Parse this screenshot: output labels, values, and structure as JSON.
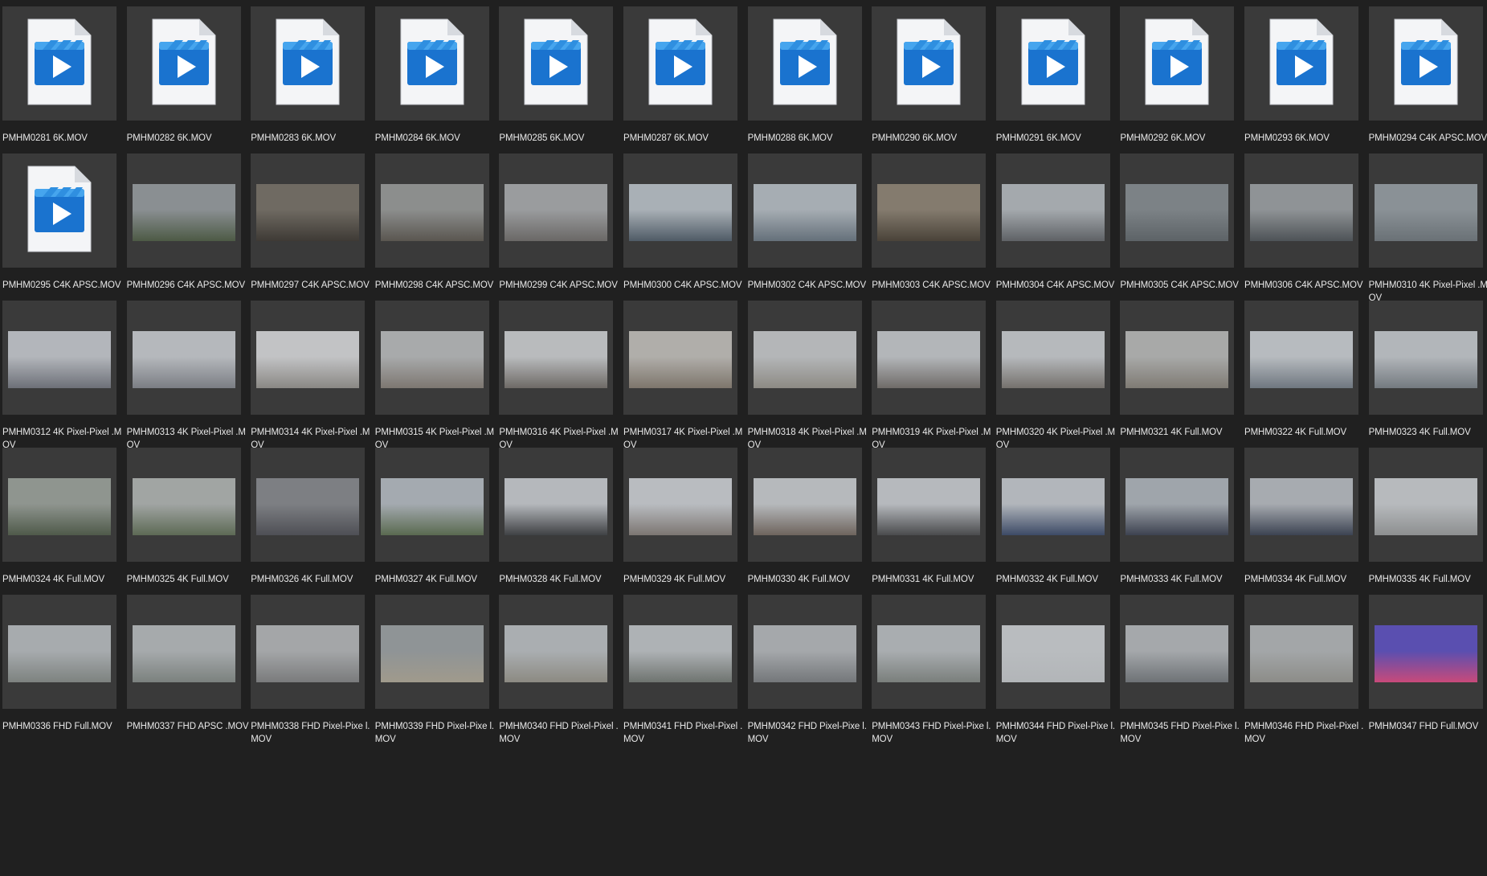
{
  "window": {
    "title": ""
  },
  "icons": {
    "video_file": "video-file-icon"
  },
  "colors": {
    "background": "#202020",
    "tile": "#3a3a3a",
    "label": "#e8e8e8",
    "icon_accent": "#1e7fd6"
  },
  "files": [
    {
      "label": "PMHM0281 6K.MOV",
      "kind": "icon"
    },
    {
      "label": "PMHM0282 6K.MOV",
      "kind": "icon"
    },
    {
      "label": "PMHM0283 6K.MOV",
      "kind": "icon"
    },
    {
      "label": "PMHM0284 6K.MOV",
      "kind": "icon"
    },
    {
      "label": "PMHM0285 6K.MOV",
      "kind": "icon"
    },
    {
      "label": "PMHM0287 6K.MOV",
      "kind": "icon"
    },
    {
      "label": "PMHM0288 6K.MOV",
      "kind": "icon"
    },
    {
      "label": "PMHM0290 6K.MOV",
      "kind": "icon"
    },
    {
      "label": "PMHM0291 6K.MOV",
      "kind": "icon"
    },
    {
      "label": "PMHM0292 6K.MOV",
      "kind": "icon"
    },
    {
      "label": "PMHM0293 6K.MOV",
      "kind": "icon"
    },
    {
      "label": "PMHM0294 C4K APSC.MOV",
      "kind": "icon"
    },
    {
      "label": "PMHM0295 C4K APSC.MOV",
      "kind": "icon"
    },
    {
      "label": "PMHM0296 C4K APSC.MOV",
      "kind": "photo",
      "tone": [
        "#8a8f92",
        "#4d5a45"
      ]
    },
    {
      "label": "PMHM0297 C4K APSC.MOV",
      "kind": "photo",
      "tone": [
        "#6f6a62",
        "#3e3a35"
      ]
    },
    {
      "label": "PMHM0298 C4K APSC.MOV",
      "kind": "photo",
      "tone": [
        "#8c8e8d",
        "#5a5650"
      ]
    },
    {
      "label": "PMHM0299 C4K APSC.MOV",
      "kind": "photo",
      "tone": [
        "#9a9c9e",
        "#6a6866"
      ]
    },
    {
      "label": "PMHM0300 C4K APSC.MOV",
      "kind": "photo",
      "tone": [
        "#a9b0b6",
        "#4f5b66"
      ]
    },
    {
      "label": "PMHM0302 C4K APSC.MOV",
      "kind": "photo",
      "tone": [
        "#a6adb3",
        "#65707a"
      ]
    },
    {
      "label": "PMHM0303 C4K APSC.MOV",
      "kind": "photo",
      "tone": [
        "#847b6e",
        "#4a4339"
      ]
    },
    {
      "label": "PMHM0304 C4K APSC.MOV",
      "kind": "photo",
      "tone": [
        "#a4a9ad",
        "#5f6266"
      ]
    },
    {
      "label": "PMHM0305 C4K APSC.MOV",
      "kind": "photo",
      "tone": [
        "#7c8286",
        "#5d6367"
      ]
    },
    {
      "label": "PMHM0306 C4K APSC.MOV",
      "kind": "photo",
      "tone": [
        "#8f9396",
        "#4e5357"
      ]
    },
    {
      "label": "PMHM0310 4K Pixel-Pixel .MOV",
      "kind": "photo",
      "tone": [
        "#8a9196",
        "#6a7176"
      ]
    },
    {
      "label": "PMHM0312 4K Pixel-Pixel .MOV",
      "kind": "photo",
      "tone": [
        "#b3b6bb",
        "#6d7078"
      ]
    },
    {
      "label": "PMHM0313 4K Pixel-Pixel .MOV",
      "kind": "photo",
      "tone": [
        "#b5b8bc",
        "#7b7e84"
      ]
    },
    {
      "label": "PMHM0314 4K Pixel-Pixel .MOV",
      "kind": "photo",
      "tone": [
        "#c2c3c5",
        "#8a8884"
      ]
    },
    {
      "label": "PMHM0315 4K Pixel-Pixel .MOV",
      "kind": "photo",
      "tone": [
        "#a8aaab",
        "#7d7771"
      ]
    },
    {
      "label": "PMHM0316 4K Pixel-Pixel .MOV",
      "kind": "photo",
      "tone": [
        "#b9bbbd",
        "#6e6a66"
      ]
    },
    {
      "label": "PMHM0317 4K Pixel-Pixel .MOV",
      "kind": "photo",
      "tone": [
        "#b0aeaa",
        "#7e766c"
      ]
    },
    {
      "label": "PMHM0318 4K Pixel-Pixel .MOV",
      "kind": "photo",
      "tone": [
        "#b4b6b8",
        "#8d8a84"
      ]
    },
    {
      "label": "PMHM0319 4K Pixel-Pixel .MOV",
      "kind": "photo",
      "tone": [
        "#b3b6b9",
        "#6f6b68"
      ]
    },
    {
      "label": "PMHM0320 4K Pixel-Pixel .MOV",
      "kind": "photo",
      "tone": [
        "#b6b9bc",
        "#75716d"
      ]
    },
    {
      "label": "PMHM0321 4K Full.MOV",
      "kind": "photo",
      "tone": [
        "#a8a9a8",
        "#7f7b74"
      ]
    },
    {
      "label": "PMHM0322 4K Full.MOV",
      "kind": "photo",
      "tone": [
        "#b7bbbf",
        "#6f7780"
      ]
    },
    {
      "label": "PMHM0323 4K Full.MOV",
      "kind": "photo",
      "tone": [
        "#b2b6ba",
        "#747a80"
      ]
    },
    {
      "label": "PMHM0324 4K Full.MOV",
      "kind": "photo",
      "tone": [
        "#8f958f",
        "#4f5a4a"
      ]
    },
    {
      "label": "PMHM0325 4K Full.MOV",
      "kind": "photo",
      "tone": [
        "#a1a5a3",
        "#5d6a55"
      ]
    },
    {
      "label": "PMHM0326 4K Full.MOV",
      "kind": "photo",
      "tone": [
        "#7d7f83",
        "#4e4f55"
      ]
    },
    {
      "label": "PMHM0327 4K Full.MOV",
      "kind": "photo",
      "tone": [
        "#a4aab0",
        "#5a6a50"
      ]
    },
    {
      "label": "PMHM0328 4K Full.MOV",
      "kind": "photo",
      "tone": [
        "#b5b8bc",
        "#3f4144"
      ]
    },
    {
      "label": "PMHM0329 4K Full.MOV",
      "kind": "photo",
      "tone": [
        "#b9bcc0",
        "#7c7672"
      ]
    },
    {
      "label": "PMHM0330 4K Full.MOV",
      "kind": "photo",
      "tone": [
        "#b6b9bc",
        "#6e645d"
      ]
    },
    {
      "label": "PMHM0331 4K Full.MOV",
      "kind": "photo",
      "tone": [
        "#b6b9bd",
        "#4a4b4d"
      ]
    },
    {
      "label": "PMHM0332 4K Full.MOV",
      "kind": "photo",
      "tone": [
        "#b2b6bb",
        "#3c4a66"
      ]
    },
    {
      "label": "PMHM0333 4K Full.MOV",
      "kind": "photo",
      "tone": [
        "#9fa5ab",
        "#3d4250"
      ]
    },
    {
      "label": "PMHM0334 4K Full.MOV",
      "kind": "photo",
      "tone": [
        "#a7abb0",
        "#3c4352"
      ]
    },
    {
      "label": "PMHM0335 4K Full.MOV",
      "kind": "photo",
      "tone": [
        "#b7babd",
        "#8d8f90"
      ]
    },
    {
      "label": "PMHM0336 FHD Full.MOV",
      "kind": "photo",
      "tone": [
        "#a7abae",
        "#7d827f"
      ]
    },
    {
      "label": "PMHM0337 FHD APSC .MOV",
      "kind": "photo",
      "tone": [
        "#a6aaac",
        "#7b817e"
      ]
    },
    {
      "label": "PMHM0338 FHD Pixel-Pixe l.MOV",
      "kind": "photo",
      "tone": [
        "#a4a6a8",
        "#7a7b7c"
      ]
    },
    {
      "label": "PMHM0339 FHD Pixel-Pixe l.MOV",
      "kind": "photo",
      "tone": [
        "#8f9496",
        "#a09a8c"
      ]
    },
    {
      "label": "PMHM0340 FHD Pixel-Pixel .MOV",
      "kind": "photo",
      "tone": [
        "#aaaeb1",
        "#8c8a82"
      ]
    },
    {
      "label": "PMHM0341 FHD Pixel-Pixel .MOV",
      "kind": "photo",
      "tone": [
        "#aeb2b5",
        "#6f7470"
      ]
    },
    {
      "label": "PMHM0342 FHD Pixel-Pixe l.MOV",
      "kind": "photo",
      "tone": [
        "#a5a8ab",
        "#74777a"
      ]
    },
    {
      "label": "PMHM0343 FHD Pixel-Pixe l.MOV",
      "kind": "photo",
      "tone": [
        "#a9adb0",
        "#7a7f7c"
      ]
    },
    {
      "label": "PMHM0344 FHD Pixel-Pixe l.MOV",
      "kind": "photo",
      "tone": [
        "#b9bcbf",
        "#b2b5b8"
      ]
    },
    {
      "label": "PMHM0345 FHD Pixel-Pixe l.MOV",
      "kind": "photo",
      "tone": [
        "#a5a8ab",
        "#6e7276"
      ]
    },
    {
      "label": "PMHM0346 FHD Pixel-Pixel .MOV",
      "kind": "photo",
      "tone": [
        "#a3a6a8",
        "#8c8c88"
      ]
    },
    {
      "label": "PMHM0347 FHD Full.MOV",
      "kind": "photo",
      "tone": [
        "#5a4fb0",
        "#c84a7a"
      ]
    }
  ]
}
